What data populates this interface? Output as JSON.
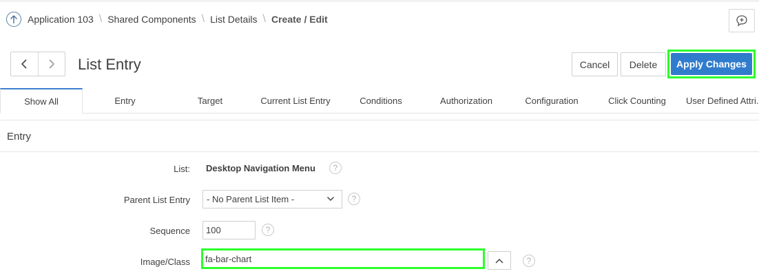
{
  "breadcrumb": {
    "items": [
      "Application 103",
      "Shared Components",
      "List Details"
    ],
    "current": "Create / Edit"
  },
  "page": {
    "title": "List Entry"
  },
  "buttons": {
    "cancel": "Cancel",
    "delete": "Delete",
    "apply": "Apply Changes"
  },
  "tabs": [
    {
      "label": "Show All",
      "active": true
    },
    {
      "label": "Entry"
    },
    {
      "label": "Target"
    },
    {
      "label": "Current List Entry"
    },
    {
      "label": "Conditions"
    },
    {
      "label": "Authorization"
    },
    {
      "label": "Configuration"
    },
    {
      "label": "Click Counting"
    },
    {
      "label": "User Defined Attri..."
    }
  ],
  "region": {
    "title": "Entry"
  },
  "form": {
    "list": {
      "label": "List:",
      "value": "Desktop Navigation Menu"
    },
    "parent": {
      "label": "Parent List Entry",
      "value": "- No Parent List Item -"
    },
    "sequence": {
      "label": "Sequence",
      "value": "100"
    },
    "image": {
      "label": "Image/Class",
      "value": "fa-bar-chart"
    }
  },
  "icons": {
    "up": "arrow-up-icon",
    "feedback": "feedback-icon",
    "prev": "chevron-left-icon",
    "next": "chevron-right-icon",
    "help": "question-mark-icon"
  },
  "colors": {
    "accent": "#2f7ccd",
    "highlight": "#2aff2a"
  }
}
